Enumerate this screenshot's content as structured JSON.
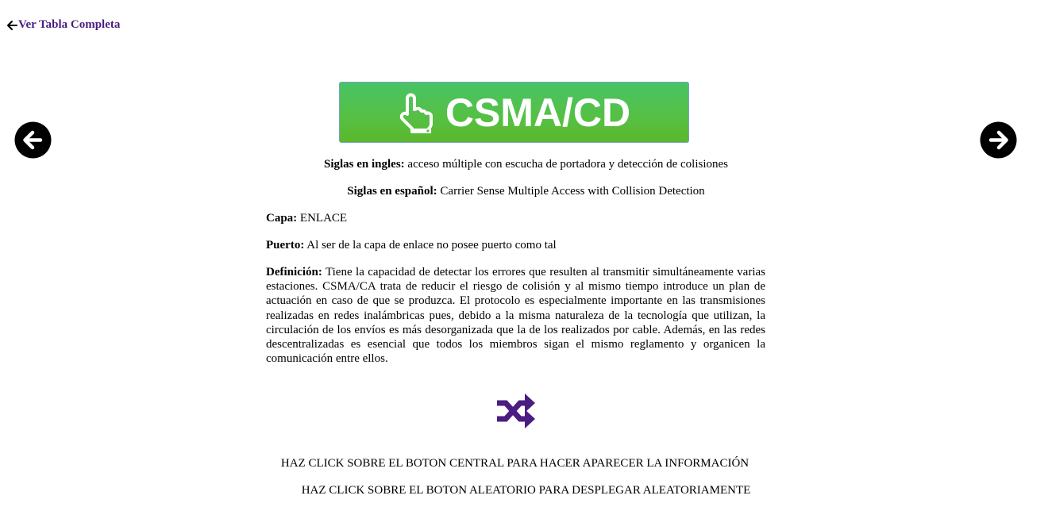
{
  "nav": {
    "back_label": "Ver Tabla Completa",
    "back_icon": "arrow-left-icon",
    "prev_icon": "circle-arrow-left-icon",
    "next_icon": "circle-arrow-right-icon"
  },
  "card": {
    "title": "CSMA/CD",
    "title_icon": "hand-pointer-icon",
    "button_color": "#52bf4a",
    "siglas_ingles_label": "Siglas en ingles:",
    "siglas_ingles_value": "acceso múltiple con escucha de portadora y detección de colisiones",
    "siglas_espanol_label": "Siglas en español:",
    "siglas_espanol_value": "Carrier Sense Multiple Access with Collision Detection",
    "capa_label": "Capa:",
    "capa_value": "ENLACE",
    "puerto_label": "Puerto:",
    "puerto_value": "Al ser de la capa de enlace no posee puerto como tal",
    "definicion_label": "Definición:",
    "definicion_value": "Tiene la capacidad de detectar los errores que resulten al transmitir simultáneamente varias estaciones. CSMA/CA trata de reducir el riesgo de colisión y al mismo tiempo introduce un plan de actuación en caso de que se produzca. El protocolo es especialmente importante en las transmisiones realizadas en redes inalámbricas pues, debido a la misma naturaleza de la tecnología que utilizan, la circulación de los envíos es más desorganizada que la de los realizados por cable. Además, en las redes descentralizadas es esencial que todos los miembros sigan el mismo reglamento y organicen la comunicación entre ellos."
  },
  "random": {
    "icon": "shuffle-icon",
    "color": "#4b1d82"
  },
  "instructions": {
    "line1": "HAZ CLICK SOBRE EL BOTON CENTRAL PARA HACER APARECER LA INFORMACIÓN",
    "line2": "HAZ CLICK SOBRE EL BOTON ALEATORIO PARA DESPLEGAR ALEATORIAMENTE"
  }
}
